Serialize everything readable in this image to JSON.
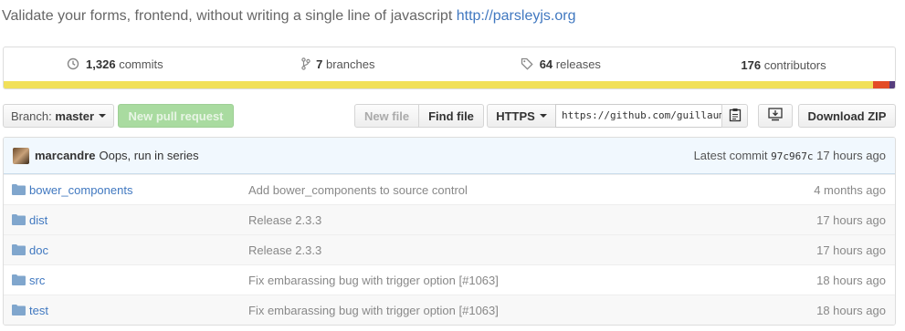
{
  "repo": {
    "description": "Validate your forms, frontend, without writing a single line of javascript",
    "homepage": "http://parsleyjs.org"
  },
  "stats": [
    {
      "icon": "history-icon",
      "count": "1,326",
      "label": "commits"
    },
    {
      "icon": "branch-icon",
      "count": "7",
      "label": "branches"
    },
    {
      "icon": "tag-icon",
      "count": "64",
      "label": "releases"
    },
    {
      "icon": "people-icon",
      "count": "176",
      "label": "contributors"
    }
  ],
  "languages": [
    {
      "color": "#f1e05a",
      "share": 0.975
    },
    {
      "color": "#e34c26",
      "share": 0.019
    },
    {
      "color": "#563d7c",
      "share": 0.006
    }
  ],
  "toolbar": {
    "branch_prefix": "Branch:",
    "branch_name": "master",
    "new_pr": "New pull request",
    "new_file": "New file",
    "find_file": "Find file",
    "protocol": "HTTPS",
    "clone_url": "https://github.com/guillaumepotier/Parsley.js.git",
    "download_zip": "Download ZIP"
  },
  "latest_commit": {
    "author": "marcandre",
    "message": "Oops, run in series",
    "prefix": "Latest commit",
    "sha": "97c967c",
    "age": "17 hours ago"
  },
  "files": [
    {
      "name": "bower_components",
      "message": "Add bower_components to source control",
      "age": "4 months ago"
    },
    {
      "name": "dist",
      "message": "Release 2.3.3",
      "age": "17 hours ago"
    },
    {
      "name": "doc",
      "message": "Release 2.3.3",
      "age": "17 hours ago"
    },
    {
      "name": "src",
      "message": "Fix embarassing bug with trigger option [#1063]",
      "age": "18 hours ago"
    },
    {
      "name": "test",
      "message": "Fix embarassing bug with trigger option [#1063]",
      "age": "18 hours ago"
    }
  ]
}
